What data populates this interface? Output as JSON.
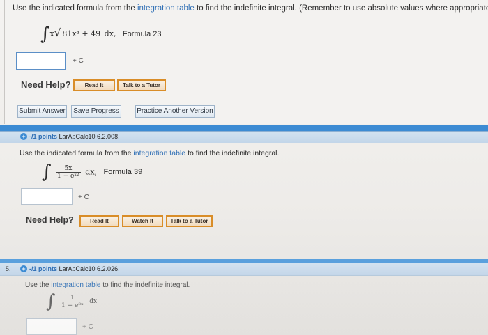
{
  "q4": {
    "prompt_a": "Use the indicated formula from the ",
    "prompt_link": "integration table",
    "prompt_b": " to find the indefinite integral. (Remember to use absolute values where appropriate.)",
    "integral_sign": "∫",
    "integrand_x": "x",
    "radical_sign": "√",
    "radicand": "81x⁴ + 49",
    "dx": " dx,",
    "formula": "Formula 23",
    "answer_value": "",
    "plus_c": "+ C",
    "need_help": "Need Help?",
    "read_it": "Read It",
    "talk_to_tutor": "Talk to a Tutor",
    "submit_answer": "Submit Answer",
    "save_progress": "Save Progress",
    "practice_another": "Practice Another Version"
  },
  "q5": {
    "points": "-/1 points",
    "source": "LarApCalc10 6.2.008.",
    "prompt_a": "Use the indicated formula from the ",
    "prompt_link": "integration table",
    "prompt_b": " to find the indefinite integral.",
    "integral_sign": "∫",
    "numerator": "5x",
    "denominator": "1 + eˣ²",
    "dx": "dx,",
    "formula": "Formula 39",
    "plus_c": "+ C",
    "need_help": "Need Help?",
    "read_it": "Read It",
    "watch_it": "Watch It",
    "talk_to_tutor": "Talk to a Tutor"
  },
  "q6": {
    "number": "5.",
    "points": "-/1 points",
    "source": "LarApCalc10 6.2.026.",
    "prompt_a": "Use the ",
    "prompt_link": "integration table",
    "prompt_b": " to find the indefinite integral.",
    "integral_sign": "∫",
    "numerator": "1",
    "denominator": "1 + e⁸ˣ",
    "dx": "dx",
    "plus_c": "+ C"
  },
  "colors": {
    "accent": "#3c8bd3",
    "link": "#2f6fb5",
    "help_border": "#d98d28"
  }
}
